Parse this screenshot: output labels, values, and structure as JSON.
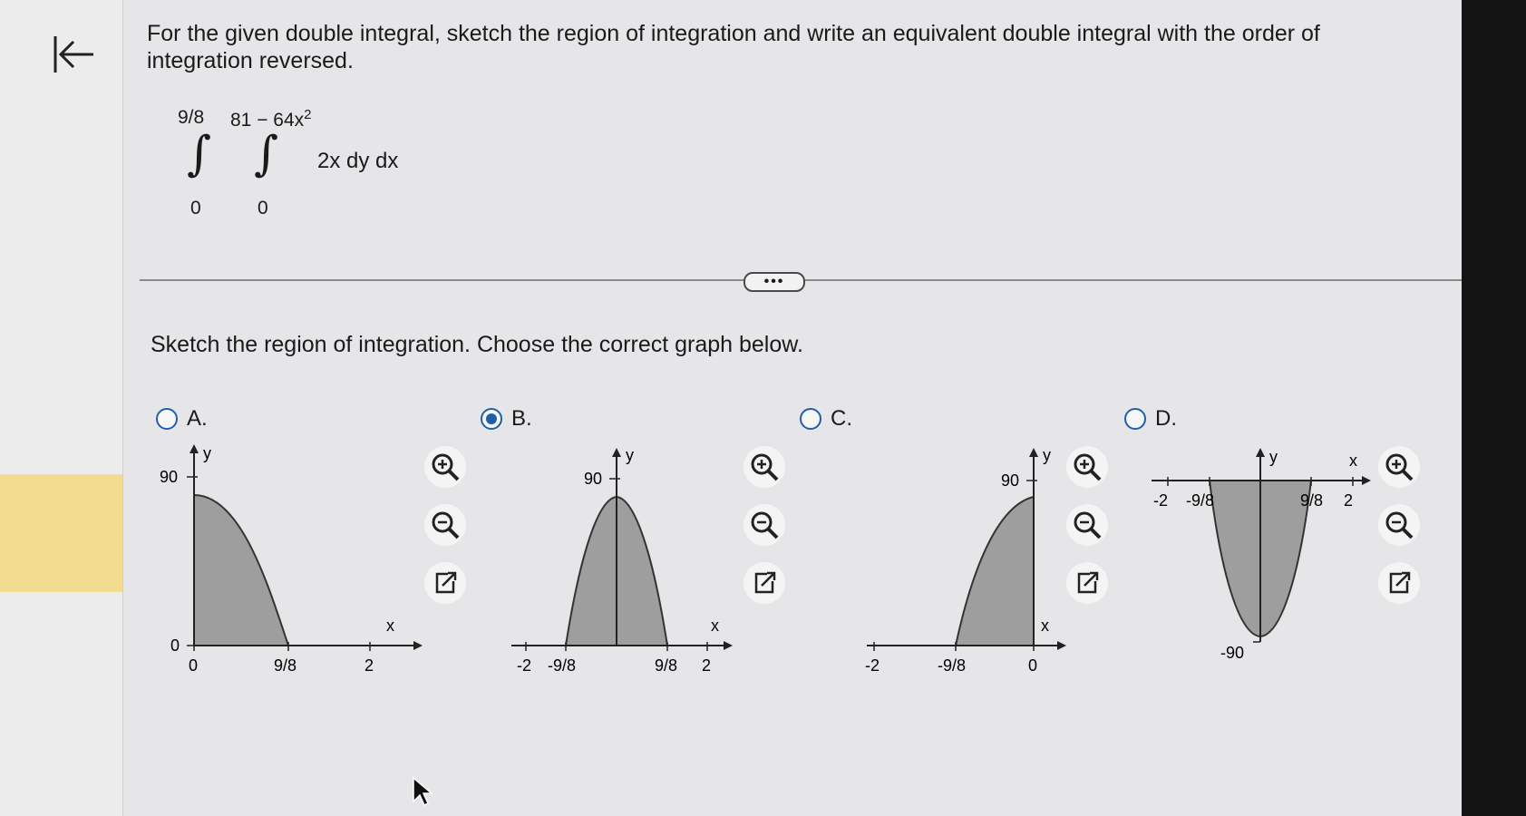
{
  "question": {
    "text": "For the given double integral, sketch the region of integration and write an equivalent double integral with the order of integration reversed."
  },
  "integral": {
    "outer_upper": "9/8",
    "outer_lower": "0",
    "inner_upper": "81 − 64x",
    "inner_upper_exp": "2",
    "inner_lower": "0",
    "integrand": "2x dy dx"
  },
  "more_button": "•••",
  "prompt": "Sketch the region of integration. Choose the correct graph below.",
  "options": [
    {
      "label": "A.",
      "selected": false,
      "graph": {
        "x_label": "x",
        "y_label": "y",
        "x_ticks": [
          "0",
          "9/8",
          "2"
        ],
        "y_ticks": [
          "90",
          "0"
        ]
      }
    },
    {
      "label": "B.",
      "selected": true,
      "graph": {
        "x_label": "x",
        "y_label": "y",
        "x_ticks": [
          "-2",
          "-9/8",
          "9/8",
          "2"
        ],
        "y_ticks": [
          "90"
        ]
      }
    },
    {
      "label": "C.",
      "selected": false,
      "graph": {
        "x_label": "x",
        "y_label": "y",
        "x_ticks": [
          "-2",
          "-9/8",
          "0"
        ],
        "y_ticks": [
          "90"
        ]
      }
    },
    {
      "label": "D.",
      "selected": false,
      "graph": {
        "x_label": "x",
        "y_label": "y",
        "x_ticks": [
          "-2",
          "-9/8",
          "9/8",
          "2"
        ],
        "y_ticks": [
          "-90"
        ]
      }
    }
  ],
  "colors": {
    "accent": "#1f5fa8",
    "region_fill": "#9e9e9e",
    "tool_icon": "#1f5fa8"
  },
  "icons": {
    "back": "back-to-start-icon",
    "zoom_in": "zoom-in-icon",
    "zoom_out": "zoom-out-icon",
    "popout": "popout-icon"
  }
}
